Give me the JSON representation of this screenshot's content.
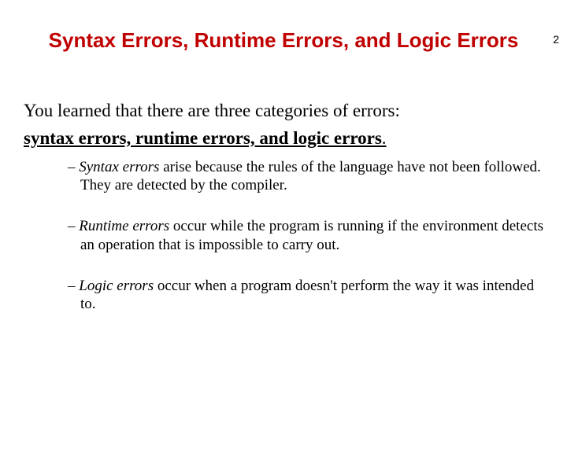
{
  "pageNumber": "2",
  "title": "Syntax Errors, Runtime Errors, and Logic Errors",
  "intro": "You learned that there are three categories of errors:",
  "introBold": "syntax errors, runtime errors, and logic errors",
  "introPeriod": ".",
  "bullets": [
    {
      "dash": "– ",
      "term": "Syntax errors",
      "rest": " arise because the rules of the language have not been followed. They are detected by the compiler."
    },
    {
      "dash": "– ",
      "term": "Runtime errors",
      "rest": " occur while the program is running if the environment detects an operation that is impossible to carry out."
    },
    {
      "dash": "– ",
      "term": "Logic errors",
      "rest": " occur when a program doesn't perform the way it was intended to."
    }
  ]
}
